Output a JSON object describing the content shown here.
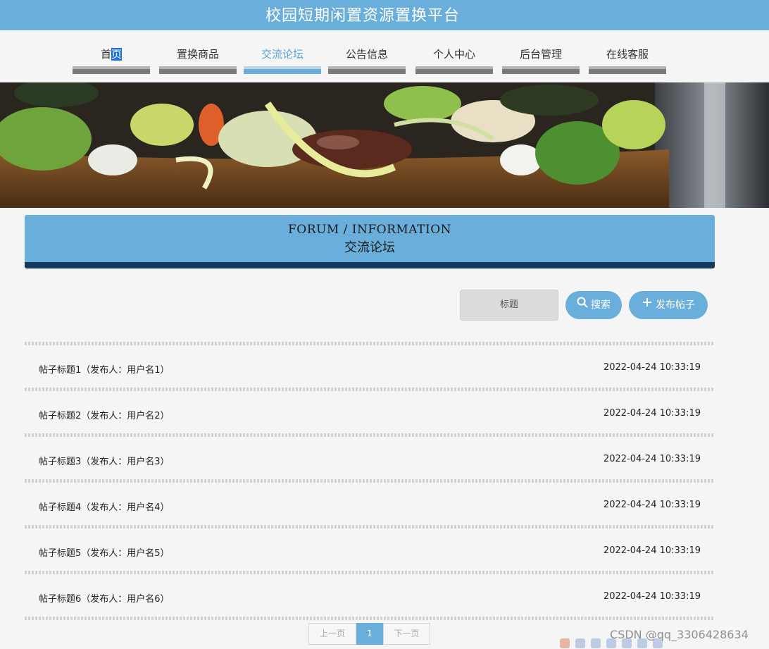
{
  "header": {
    "site_title": "校园短期闲置资源置换平台"
  },
  "nav": {
    "items": [
      {
        "label": "首页",
        "active": false
      },
      {
        "label": "置换商品",
        "active": false
      },
      {
        "label": "交流论坛",
        "active": true
      },
      {
        "label": "公告信息",
        "active": false
      },
      {
        "label": "个人中心",
        "active": false
      },
      {
        "label": "后台管理",
        "active": false
      },
      {
        "label": "在线客服",
        "active": false
      }
    ]
  },
  "section": {
    "title_en": "FORUM / INFORMATION",
    "title_cn": "交流论坛"
  },
  "search": {
    "placeholder": "标题",
    "search_label": "搜索",
    "post_label": "发布帖子"
  },
  "posts": [
    {
      "title": "帖子标题1（发布人：用户名1）",
      "time": "2022-04-24 10:33:19"
    },
    {
      "title": "帖子标题2（发布人：用户名2）",
      "time": "2022-04-24 10:33:19"
    },
    {
      "title": "帖子标题3（发布人：用户名3）",
      "time": "2022-04-24 10:33:19"
    },
    {
      "title": "帖子标题4（发布人：用户名4）",
      "time": "2022-04-24 10:33:19"
    },
    {
      "title": "帖子标题5（发布人：用户名5）",
      "time": "2022-04-24 10:33:19"
    },
    {
      "title": "帖子标题6（发布人：用户名6）",
      "time": "2022-04-24 10:33:19"
    }
  ],
  "pagination": {
    "prev": "上一页",
    "current": "1",
    "next": "下一页"
  },
  "watermark": "CSDN @qq_3306428634",
  "colors": {
    "primary": "#6aaedb",
    "dark_band": "#123a5e",
    "background": "#f5f5f5"
  }
}
